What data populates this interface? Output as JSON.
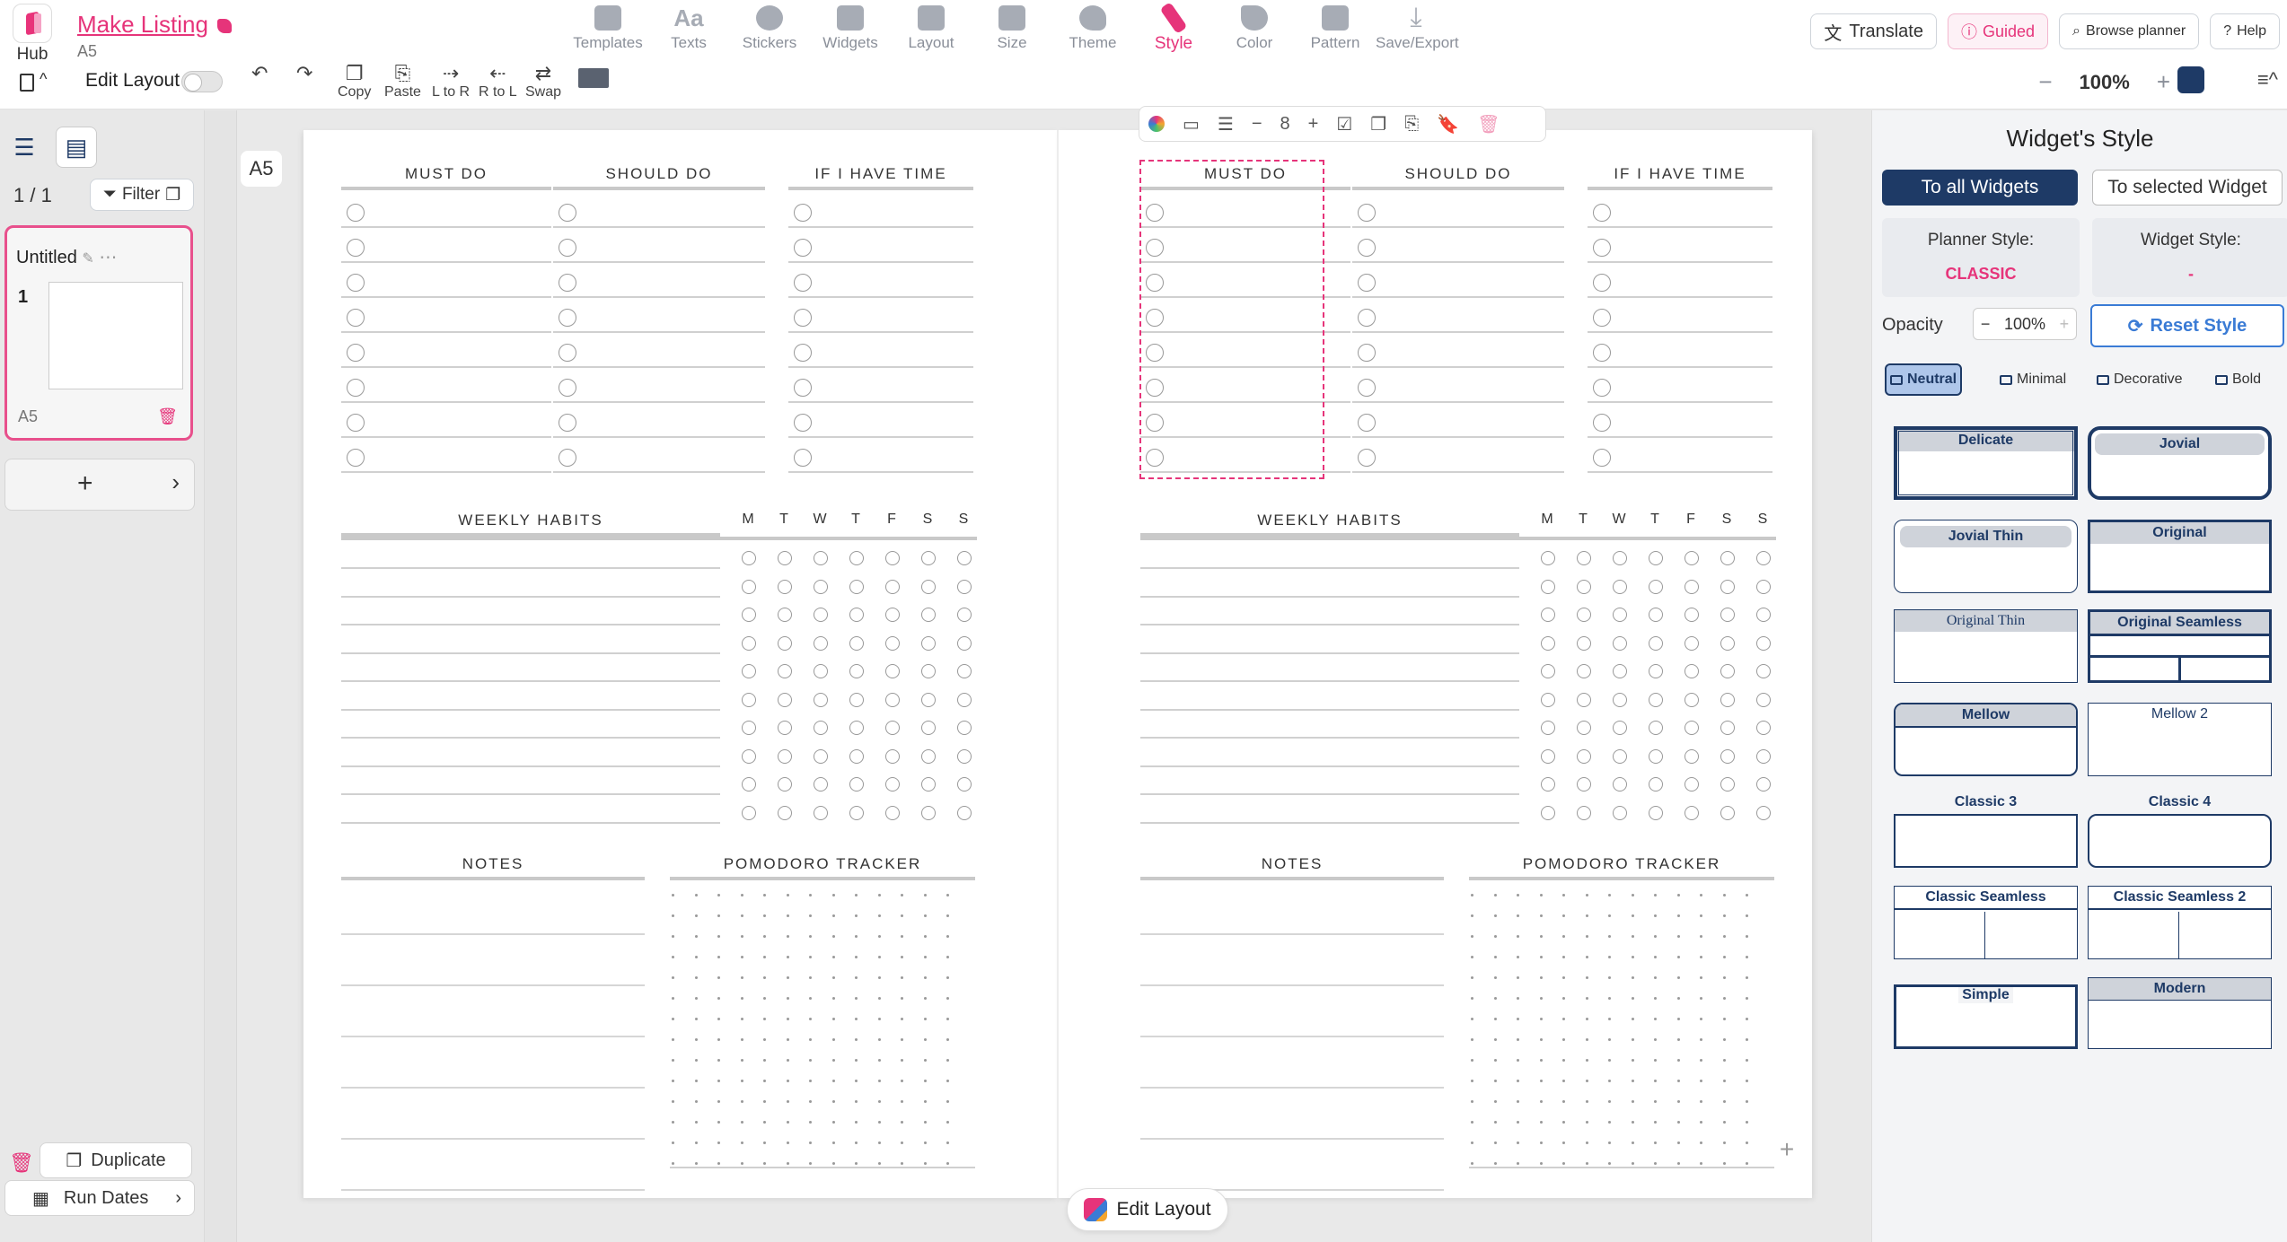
{
  "hub": {
    "label": "Hub"
  },
  "listing": {
    "title": "Make Listing",
    "size": "A5"
  },
  "menu": [
    {
      "label": "Templates",
      "icon": "templates-icon"
    },
    {
      "label": "Texts",
      "icon": "texts-icon",
      "glyph": "Aa"
    },
    {
      "label": "Stickers",
      "icon": "stickers-icon"
    },
    {
      "label": "Widgets",
      "icon": "widgets-icon"
    },
    {
      "label": "Layout",
      "icon": "layout-icon"
    },
    {
      "label": "Size",
      "icon": "size-icon"
    },
    {
      "label": "Theme",
      "icon": "theme-icon"
    },
    {
      "label": "Style",
      "icon": "style-icon",
      "active": true
    },
    {
      "label": "Color",
      "icon": "color-icon"
    },
    {
      "label": "Pattern",
      "icon": "pattern-icon"
    },
    {
      "label": "Save/Export",
      "icon": "save-export-icon"
    }
  ],
  "topright": {
    "translate": "Translate",
    "guided": "Guided",
    "browse": "Browse planner",
    "help": "Help"
  },
  "toolbar": {
    "edit_layout": "Edit Layout",
    "copy": "Copy",
    "paste": "Paste",
    "l_to_r": "L to R",
    "r_to_l": "R to L",
    "swap": "Swap",
    "zoom": "100%"
  },
  "sidebar": {
    "pager": "1 / 1",
    "filter": "Filter",
    "doc_name": "Untitled",
    "doc_page": "1",
    "doc_size": "A5",
    "duplicate": "Duplicate",
    "run_dates": "Run Dates",
    "size_tag": "A5"
  },
  "planner": {
    "todo_headers": [
      "MUST DO",
      "SHOULD DO",
      "IF I HAVE TIME"
    ],
    "habits_header": "WEEKLY HABITS",
    "days": [
      "M",
      "T",
      "W",
      "T",
      "F",
      "S",
      "S"
    ],
    "notes_header": "NOTES",
    "pomodoro_header": "POMODORO TRACKER"
  },
  "widget_toolbar": {
    "rows": "8"
  },
  "edit_layout_btn": "Edit Layout",
  "panel": {
    "title": "Widget's Style",
    "to_all": "To all Widgets",
    "to_selected": "To selected Widget",
    "planner_style_label": "Planner Style:",
    "planner_style_value": "CLASSIC",
    "widget_style_label": "Widget Style:",
    "widget_style_value": "-",
    "opacity_label": "Opacity",
    "opacity_value": "100%",
    "reset": "Reset Style",
    "categories": [
      "Neutral",
      "Minimal",
      "Decorative",
      "Bold"
    ],
    "styles": [
      "Delicate",
      "Jovial",
      "Jovial Thin",
      "Original",
      "Original Thin",
      "Original Seamless",
      "Mellow",
      "Mellow 2",
      "Classic 3",
      "Classic 4",
      "Classic Seamless",
      "Classic Seamless 2",
      "Simple",
      "Modern"
    ]
  },
  "colors": {
    "accent": "#e6347a",
    "navy": "#1e3a66",
    "blue": "#3a7bd5"
  }
}
